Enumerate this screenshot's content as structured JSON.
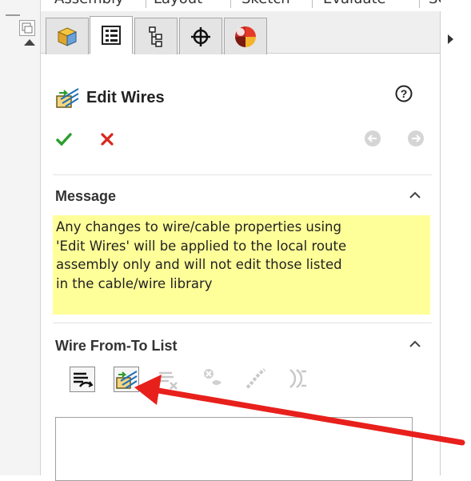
{
  "menu_tabs": [
    "Assembly",
    "Layout",
    "Sketch",
    "Evaluate",
    "SOL"
  ],
  "panel": {
    "title": "Edit Wires",
    "manager_tabs": [
      {
        "icon": "feature-manager-icon"
      },
      {
        "icon": "property-manager-icon"
      },
      {
        "icon": "configuration-manager-icon"
      },
      {
        "icon": "dimxpert-manager-icon"
      },
      {
        "icon": "display-manager-icon"
      }
    ],
    "message_section": {
      "title": "Message",
      "lines": [
        "Any changes to wire/cable properties using",
        "'Edit Wires' will be applied to the local route",
        "assembly only and will not edit those listed",
        "in the cable/wire library"
      ]
    },
    "wire_section": {
      "title": "Wire From-To List"
    }
  },
  "colors": {
    "message_bg": "#ffff99",
    "ok_green": "#2e9e2e",
    "cancel_red": "#d9261c",
    "annotation_arrow": "#e8201c"
  }
}
